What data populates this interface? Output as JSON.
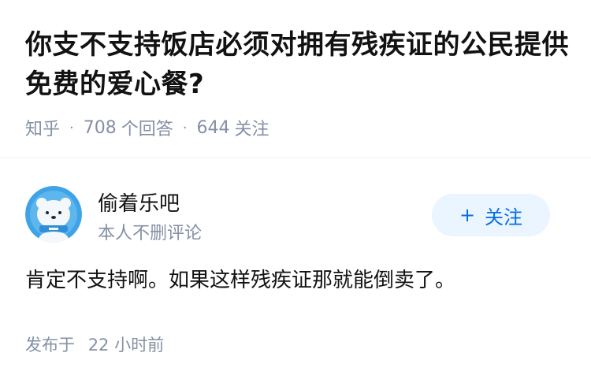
{
  "question": {
    "title": "你支不支持饭店必须对拥有残疾证的公民提供免费的爱心餐?",
    "source": "知乎",
    "answers_count": "708",
    "answers_label": "个回答",
    "followers_count": "644",
    "followers_label": "关注"
  },
  "author": {
    "name": "偷着乐吧",
    "description": "本人不删评论",
    "follow_label": "关注",
    "follow_icon": "plus-icon",
    "avatar_icon": "bear-avatar"
  },
  "answer": {
    "content": "肯定不支持啊。如果这样残疾证那就能倒卖了。",
    "published_label": "发布于",
    "published_time": "22 小时前"
  },
  "colors": {
    "primary": "#056de8",
    "follow_bg": "#ebf5ff",
    "meta_text": "#8590a6",
    "title_text": "#121212"
  }
}
